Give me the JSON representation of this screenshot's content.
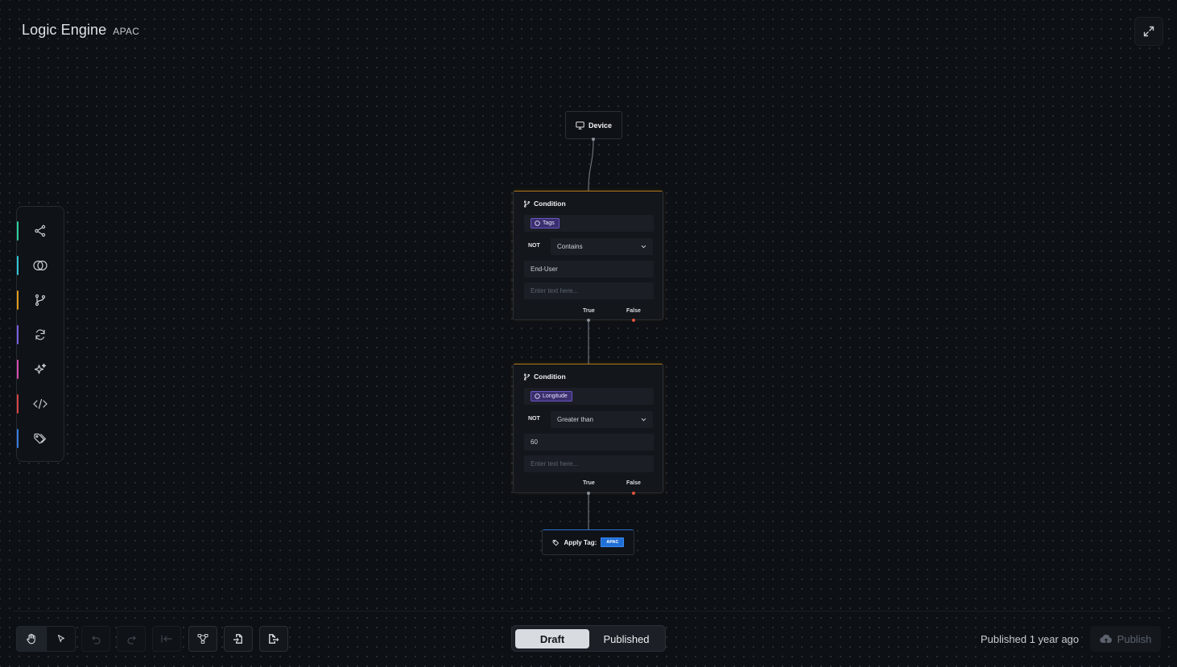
{
  "header": {
    "title": "Logic Engine",
    "subtitle": "APAC"
  },
  "palette": {
    "items": [
      {
        "icon": "share-nodes-icon",
        "color": "#2fd0a0"
      },
      {
        "icon": "overlap-circles-icon",
        "color": "#2fc6d6"
      },
      {
        "icon": "branch-icon",
        "color": "#e09a1a"
      },
      {
        "icon": "refresh-icon",
        "color": "#7a5ce0"
      },
      {
        "icon": "sparkle-icon",
        "color": "#d64bb0"
      },
      {
        "icon": "code-icon",
        "color": "#d64545"
      },
      {
        "icon": "tag-icon",
        "color": "#3a7ae0"
      }
    ]
  },
  "nodes": {
    "device": {
      "label": "Device"
    },
    "condition1": {
      "title": "Condition",
      "attribute": "Tags",
      "not_label": "NOT",
      "operator": "Contains",
      "value": "End-User",
      "placeholder": "Enter text here...",
      "true_label": "True",
      "false_label": "False"
    },
    "condition2": {
      "title": "Condition",
      "attribute": "Longitude",
      "not_label": "NOT",
      "operator": "Greater than",
      "value": "60",
      "placeholder": "Enter text here...",
      "true_label": "True",
      "false_label": "False"
    },
    "apply": {
      "label": "Apply Tag:",
      "tag": "APAC"
    }
  },
  "footer": {
    "tabs": {
      "draft": "Draft",
      "published": "Published"
    },
    "status": "Published 1 year ago",
    "publish_label": "Publish"
  },
  "colors": {
    "condition_accent": "#b07a18",
    "tag_accent": "#1f6fd6",
    "chip": "#3b2f6e"
  }
}
